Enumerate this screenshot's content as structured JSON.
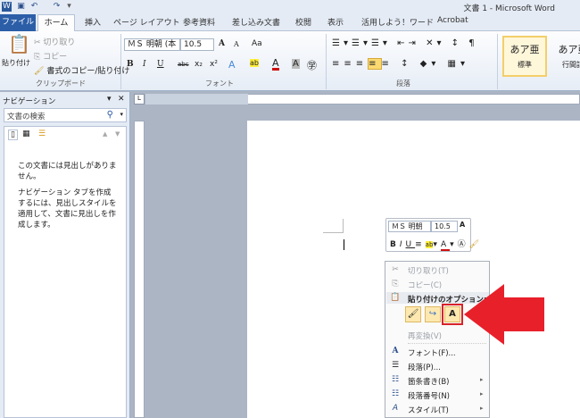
{
  "window": {
    "title": "文書 1 - Microsoft Word"
  },
  "quick_access": [
    "word-icon",
    "save-icon",
    "undo-icon",
    "redo-icon",
    "customize-icon"
  ],
  "tabs": {
    "file": "ファイル",
    "home": "ホーム",
    "items": [
      "挿入",
      "ページ レイアウト",
      "参考資料",
      "差し込み文書",
      "校閲",
      "表示",
      "活用しよう！ワード",
      "Acrobat"
    ]
  },
  "ribbon": {
    "clipboard": {
      "paste": "貼り付け",
      "cut": "切り取り",
      "copy": "コピー",
      "format_painter": "書式のコピー/貼り付け",
      "label": "クリップボード"
    },
    "font": {
      "name": "ＭＳ 明朝 (本",
      "size": "10.5",
      "label": "フォント",
      "bold": "B",
      "italic": "I",
      "underline": "U",
      "strike": "abc",
      "sub": "x₂",
      "sup": "x²",
      "grow": "A",
      "shrink": "A",
      "case": "Aa"
    },
    "paragraph": {
      "label": "段落"
    },
    "styles": {
      "items": [
        {
          "preview": "あア亜",
          "name": "標準"
        },
        {
          "preview": "あア亜",
          "name": "行間詰"
        }
      ]
    }
  },
  "nav": {
    "title": "ナビゲーション",
    "search_placeholder": "文書の検索",
    "message1": "この文書には見出しがありません。",
    "message2": "ナビゲーション タブを作成するには、見出しスタイルを適用して、文書に見出しを作成します。"
  },
  "mini_toolbar": {
    "font": "ＭＳ 明朝",
    "size": "10.5"
  },
  "context_menu": {
    "cut": "切り取り(T)",
    "copy": "コピー(C)",
    "paste_options": "貼り付けのオプション:",
    "reconvert": "再変換(V)",
    "font": "フォント(F)...",
    "paragraph": "段落(P)...",
    "bullets": "箇条書き(B)",
    "numbering": "段落番号(N)",
    "styles": "スタイル(T)"
  },
  "colors": {
    "accent": "#2c5ea8",
    "arrow": "#e8202a",
    "highlight_box": "#d8232a"
  }
}
